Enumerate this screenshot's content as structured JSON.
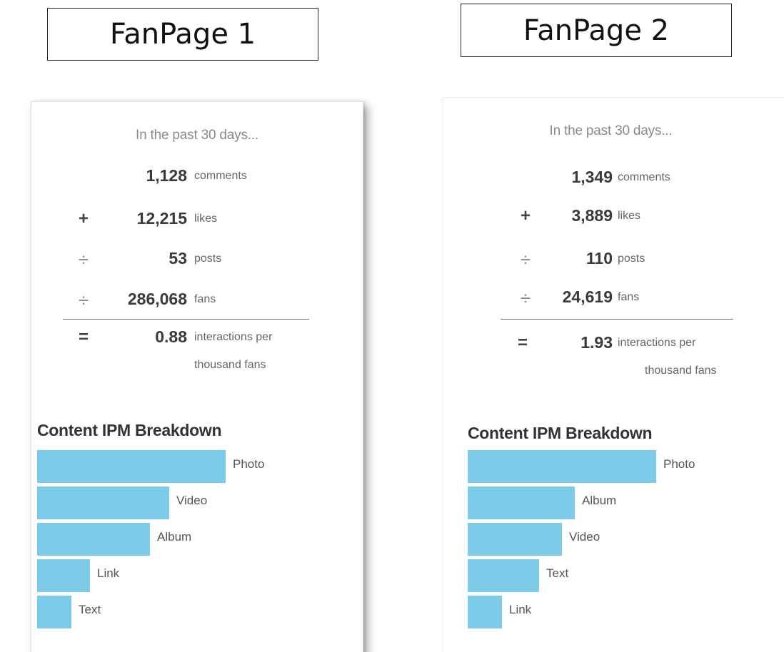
{
  "fanpages": [
    {
      "title": "FanPage 1",
      "period": "In the past 30 days...",
      "metrics": [
        {
          "op": "",
          "value": "1,128",
          "label": "comments"
        },
        {
          "op": "+",
          "value": "12,215",
          "label": "likes"
        },
        {
          "op": "÷",
          "value": "53",
          "label": "posts"
        },
        {
          "op": "÷",
          "value": "286,068",
          "label": "fans"
        }
      ],
      "result": {
        "op": "=",
        "value": "0.88",
        "label_line1": "interactions per",
        "label_line2": "thousand fans"
      },
      "breakdown_title": "Content IPM Breakdown",
      "chart_data": {
        "type": "bar",
        "orientation": "horizontal",
        "title": "Content IPM Breakdown",
        "categories": [
          "Photo",
          "Video",
          "Album",
          "Link",
          "Text"
        ],
        "values": [
          1.0,
          0.7,
          0.6,
          0.28,
          0.18
        ],
        "value_units": "relative to largest bar",
        "bar_color": "#7ecbe9"
      }
    },
    {
      "title": "FanPage 2",
      "period": "In the past 30 days...",
      "metrics": [
        {
          "op": "",
          "value": "1,349",
          "label": "comments"
        },
        {
          "op": "+",
          "value": "3,889",
          "label": "likes"
        },
        {
          "op": "÷",
          "value": "110",
          "label": "posts"
        },
        {
          "op": "÷",
          "value": "24,619",
          "label": "fans"
        }
      ],
      "result": {
        "op": "=",
        "value": "1.93",
        "label_line1": "interactions per",
        "label_line2": "thousand fans"
      },
      "breakdown_title": "Content IPM Breakdown",
      "chart_data": {
        "type": "bar",
        "orientation": "horizontal",
        "title": "Content IPM Breakdown",
        "categories": [
          "Photo",
          "Album",
          "Video",
          "Text",
          "Link"
        ],
        "values": [
          1.0,
          0.57,
          0.5,
          0.38,
          0.18
        ],
        "value_units": "relative to largest bar",
        "bar_color": "#7ecbe9"
      }
    }
  ]
}
